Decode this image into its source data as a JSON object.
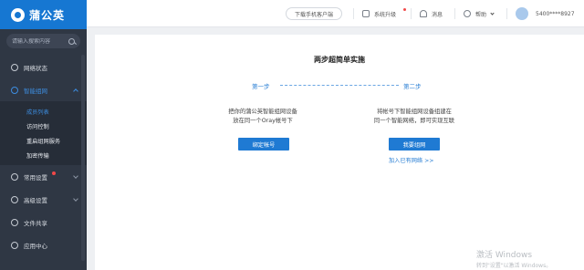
{
  "sidebar": {
    "logo": "蒲公英",
    "search_placeholder": "请输入搜索内容",
    "items": [
      {
        "label": "网络状态"
      },
      {
        "label": "智能组网",
        "sub": [
          "成员列表",
          "访问控制",
          "重启组网服务",
          "加密传输"
        ]
      },
      {
        "label": "常用设置"
      },
      {
        "label": "高级设置"
      },
      {
        "label": "文件共享"
      },
      {
        "label": "应用中心"
      }
    ]
  },
  "topbar": {
    "download": "下载手机客户端",
    "upgrade": "系统升级",
    "message": "消息",
    "help": "帮助",
    "account": "5400****8927"
  },
  "main": {
    "title": "两步超简单实施",
    "step1": {
      "label": "第一步",
      "desc_line1": "把你的蒲公英智能组网设备",
      "desc_line2": "放在同一个Oray帐号下",
      "button": "绑定帐号"
    },
    "step2": {
      "label": "第二步",
      "desc_line1": "将帐号下智能组网设备组建在",
      "desc_line2": "同一个智能网络，即可实现互联",
      "button": "我要组网",
      "link": "加入已有网络 >>"
    }
  },
  "watermark": {
    "line1": "激活 Windows",
    "line2": "转到\"设置\"以激活 Windows。"
  },
  "colors": {
    "accent": "#1677d2",
    "sidebar_bg": "#2f3744",
    "notify_dot": "#f24848"
  }
}
